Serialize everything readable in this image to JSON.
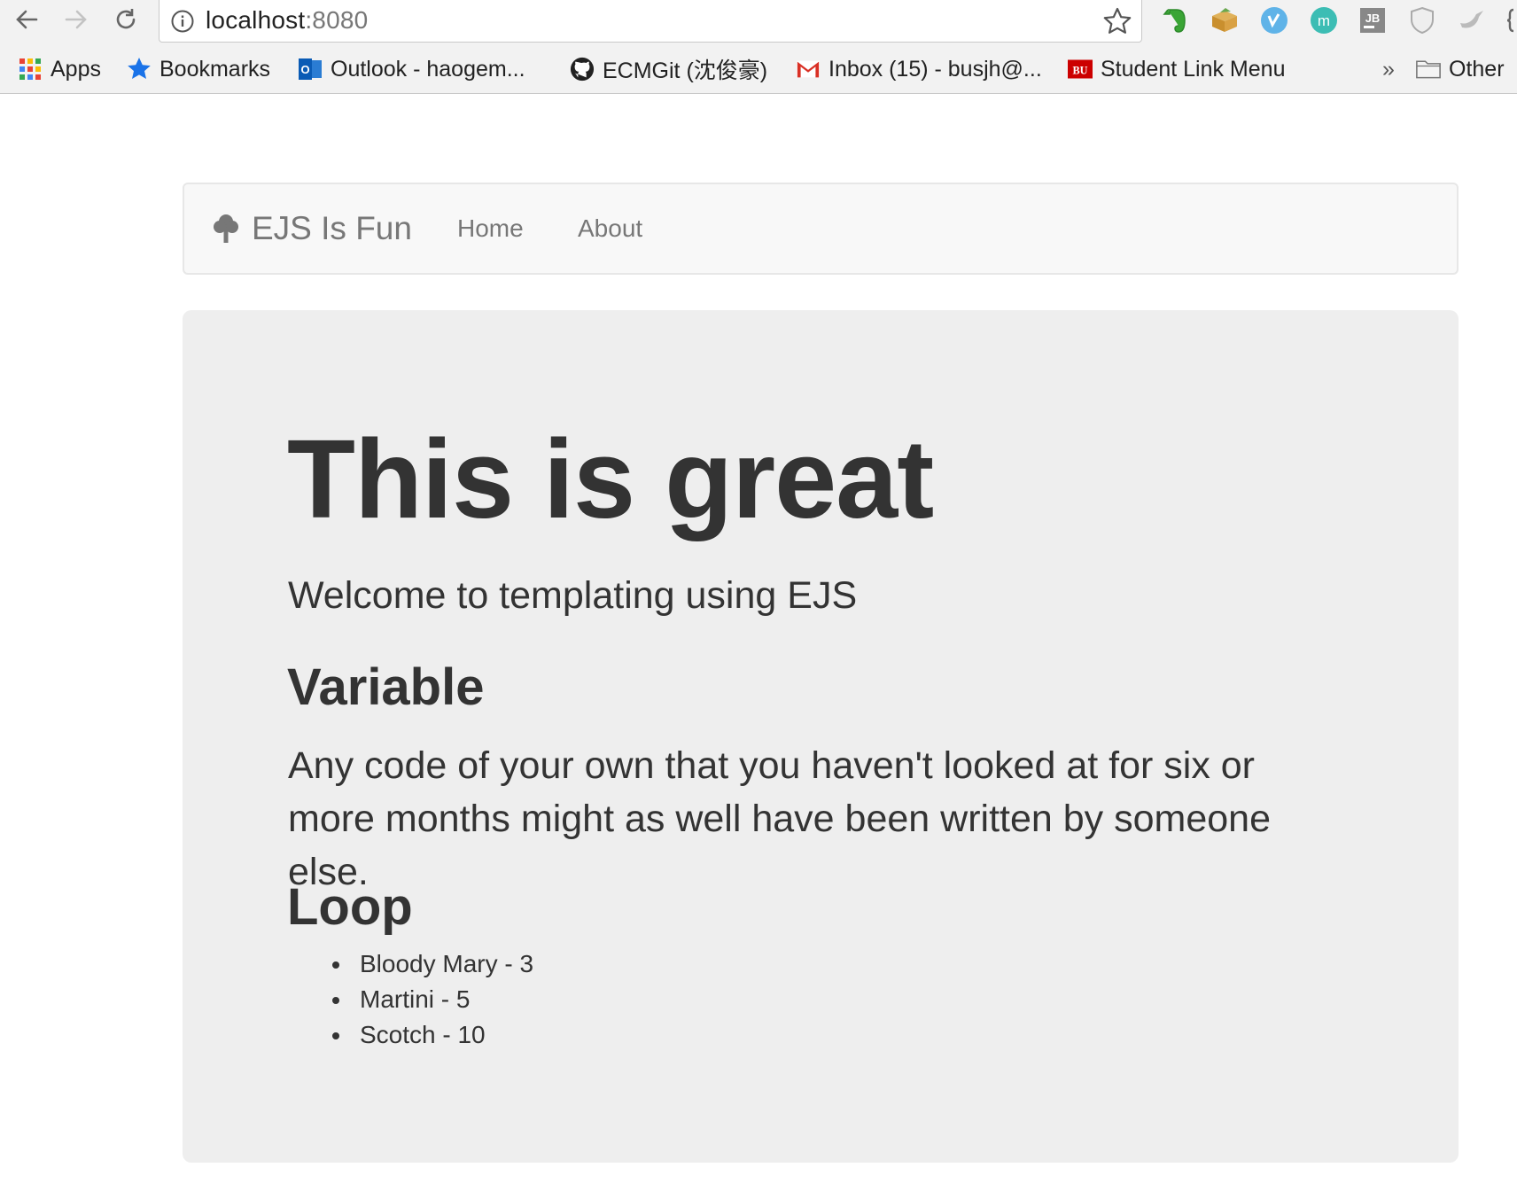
{
  "browser": {
    "url_host": "localhost",
    "url_port": ":8080",
    "bookmarks": [
      {
        "label": "Apps",
        "icon": "apps-grid-icon"
      },
      {
        "label": "Bookmarks",
        "icon": "star-icon"
      },
      {
        "label": "Outlook - haogem...",
        "icon": "outlook-icon"
      },
      {
        "label": "ECMGit (沈俊豪)",
        "icon": "github-icon"
      },
      {
        "label": "Inbox (15) - busjh@...",
        "icon": "gmail-icon"
      },
      {
        "label": "Student Link Menu",
        "icon": "bu-icon"
      }
    ],
    "overflow_label": "»",
    "other_label": "Other",
    "extensions": [
      "evernote-icon",
      "box-icon",
      "vimeo-icon",
      "m-icon",
      "jetbrains-icon",
      "shield-icon",
      "bird-icon"
    ],
    "extension_texts": {
      "m": "m",
      "jb": "JB",
      "bu": "BU"
    }
  },
  "navbar": {
    "brand": "EJS Is Fun",
    "links": [
      "Home",
      "About"
    ]
  },
  "jumbotron": {
    "title": "This is great",
    "lead": "Welcome to templating using EJS",
    "variable_heading": "Variable",
    "variable_text": "Any code of your own that you haven't looked at for six or more months might as well have been written by someone else.",
    "loop_heading": "Loop",
    "loop_items": [
      "Bloody Mary - 3",
      "Martini - 5",
      "Scotch - 10"
    ]
  },
  "colors": {
    "chrome_bg": "#f2f2f2",
    "navbar_bg": "#f8f8f8",
    "jumbotron_bg": "#eeeeee",
    "text": "#333333",
    "nav_text": "#777777"
  }
}
